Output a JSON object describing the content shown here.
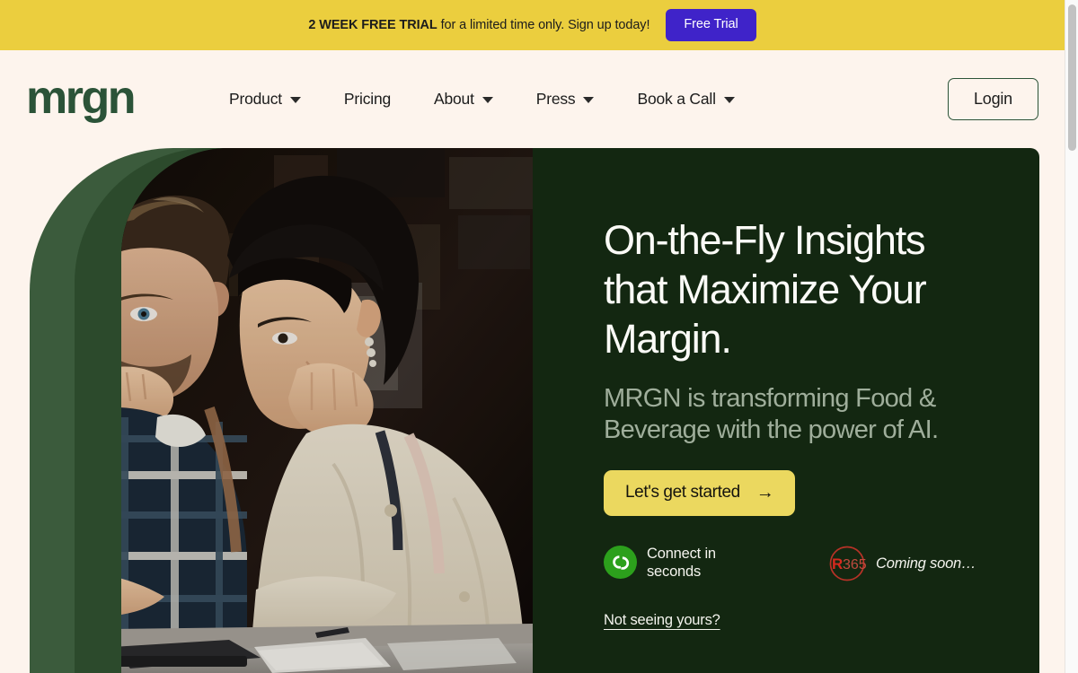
{
  "banner": {
    "bold_text": "2 WEEK FREE TRIAL",
    "rest_text": " for a limited time only. Sign up today!",
    "button_label": "Free Trial",
    "bg_color": "#EBCE3E",
    "button_color": "#3F23C9"
  },
  "nav": {
    "logo_text": "mrgn",
    "logo_color": "#2B5338",
    "items": [
      {
        "label": "Product",
        "has_caret": true
      },
      {
        "label": "Pricing",
        "has_caret": false
      },
      {
        "label": "About",
        "has_caret": true
      },
      {
        "label": "Press",
        "has_caret": true
      },
      {
        "label": "Book a Call",
        "has_caret": true
      }
    ],
    "login_label": "Login"
  },
  "hero": {
    "title_line1": "On-the-Fly Insights",
    "title_line2": "that Maximize Your",
    "title_line3": "Margin.",
    "subtitle": "MRGN is transforming Food & Beverage with the power of AI.",
    "cta_label": "Let's get started",
    "cta_arrow": "→",
    "cta_color": "#EBD85F",
    "panel_color": "#132711",
    "arch_outer_color": "#3B5B3C",
    "arch_inner_color": "#2C4A2C",
    "badges": [
      {
        "logo": "quickbooks-logo",
        "label": "Connect in seconds",
        "logo_color": "#2CA01C"
      },
      {
        "logo": "r365-logo",
        "label": "Coming soon…",
        "logo_color": "#C8342B"
      }
    ],
    "link_label": "Not seeing yours?"
  },
  "scrollbar": {
    "thumb_color": "#C2C2C2"
  }
}
